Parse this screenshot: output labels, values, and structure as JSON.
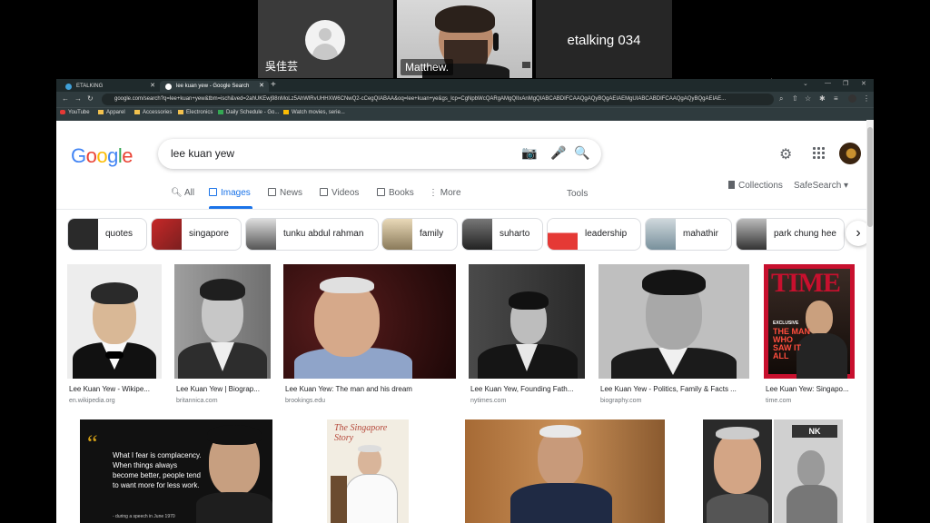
{
  "meeting": {
    "participants": [
      {
        "name": "吳佳芸",
        "video": false
      },
      {
        "name": "Matthew.",
        "video": true
      },
      {
        "name": "etalking 034",
        "video": false
      }
    ]
  },
  "browser": {
    "tabs": [
      {
        "title": "ETALKING",
        "active": false
      },
      {
        "title": "lee kuan yew - Google Search",
        "active": true
      }
    ],
    "url": "google.com/search?q=lee+kuan+yew&tbm=isch&ved=2ahUKEwj98nMoLz5AhWlRvUHHXW6CNwQ2-cCegQIABAA&oq=lee+kuan+ye&gs_lcp=CgNpbWcQARgAMgQIIxAnMgQIABCABDIFCAAQgAQyBQgAEIAEMgUIABCABDIFCAAQgAQyBQgAEIAE...",
    "bookmarks": [
      "YouTube",
      "Apparel",
      "Accessories",
      "Electronics",
      "Daily Schedule - Go...",
      "Watch movies, serie..."
    ]
  },
  "search": {
    "logo": "Google",
    "query": "lee kuan yew",
    "nav": [
      "All",
      "Images",
      "News",
      "Videos",
      "Books",
      "More"
    ],
    "active_nav": "Images",
    "tools": "Tools",
    "collections": "Collections",
    "safesearch": "SafeSearch"
  },
  "chips": [
    "quotes",
    "singapore",
    "tunku abdul rahman",
    "family",
    "suharto",
    "leadership",
    "mahathir",
    "park chung hee"
  ],
  "results": [
    {
      "title": "Lee Kuan Yew - Wikipe...",
      "source": "en.wikipedia.org"
    },
    {
      "title": "Lee Kuan Yew | Biograp...",
      "source": "britannica.com"
    },
    {
      "title": "Lee Kuan Yew: The man and his dream",
      "source": "brookings.edu"
    },
    {
      "title": "Lee Kuan Yew, Founding Fath...",
      "source": "nytimes.com"
    },
    {
      "title": "Lee Kuan Yew - Politics, Family & Facts ...",
      "source": "biography.com"
    },
    {
      "title": "Lee Kuan Yew: Singapo...",
      "source": "time.com"
    }
  ],
  "quote_card": {
    "text": "What I fear is complacency. When things always become better, people tend to want more for less work.",
    "attribution": "- during a speech in June 1970"
  },
  "book_cover": {
    "line1": "The",
    "line2": "Singapore",
    "line3": "Story"
  },
  "time_cover": {
    "masthead": "TIME",
    "kicker": "EXCLUSIVE",
    "headline": "THE MAN WHO SAW IT ALL"
  },
  "colors": {
    "accent": "#1a73e8",
    "time_red": "#c8102e"
  }
}
